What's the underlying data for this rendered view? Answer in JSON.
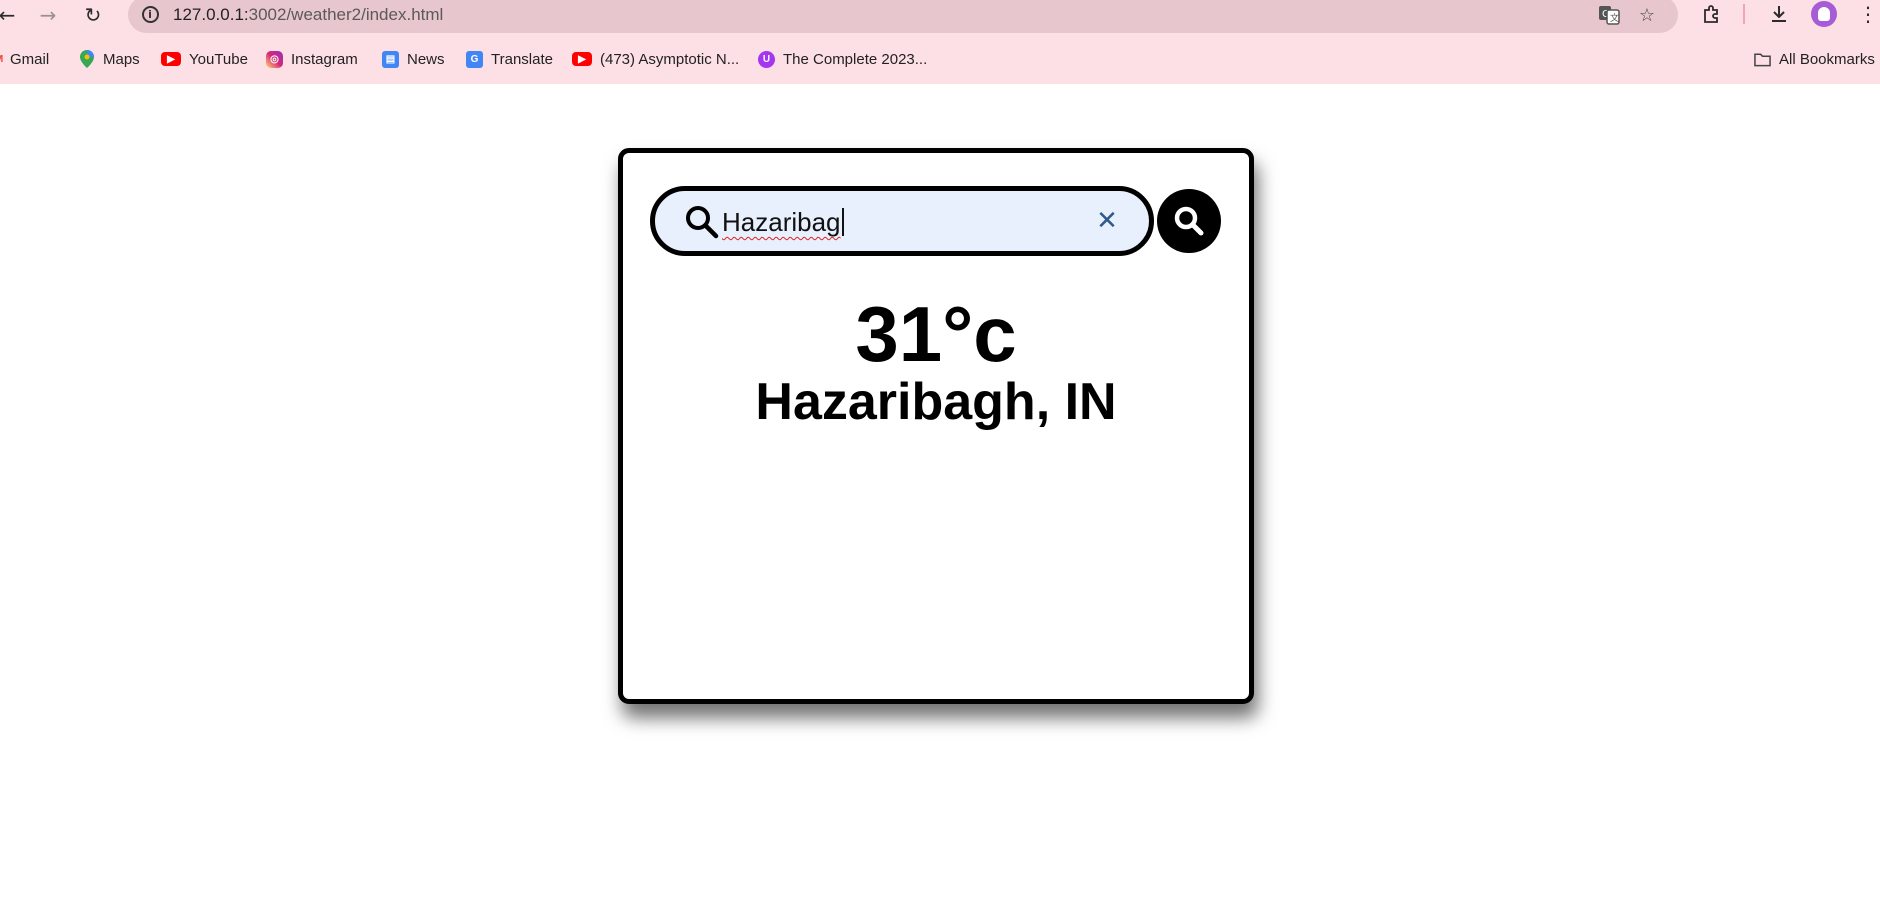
{
  "browser": {
    "url_host": "127.0.0.1:",
    "url_path": "3002/weather2/index.html",
    "bookmarks": [
      {
        "label": "Gmail",
        "icon": "gmail-icon",
        "color": "#ea4335"
      },
      {
        "label": "Maps",
        "icon": "maps-icon",
        "color": "#34a853"
      },
      {
        "label": "YouTube",
        "icon": "youtube-icon",
        "color": "#ff0000"
      },
      {
        "label": "Instagram",
        "icon": "instagram-icon",
        "color": "#d62976"
      },
      {
        "label": "News",
        "icon": "news-icon",
        "color": "#4285f4"
      },
      {
        "label": "Translate",
        "icon": "translate-icon",
        "color": "#4285f4"
      },
      {
        "label": "(473) Asymptotic N...",
        "icon": "youtube-icon",
        "color": "#ff0000"
      },
      {
        "label": "The Complete 2023...",
        "icon": "udemy-icon",
        "color": "#a435f0"
      }
    ],
    "all_bookmarks_label": "All Bookmarks"
  },
  "weather": {
    "search_value": "Hazaribag",
    "temperature": "31°c",
    "location": "Hazaribagh, IN"
  },
  "colors": {
    "chrome_bg": "#fde0e6",
    "omnibox_bg": "#e8c6cd",
    "search_field_bg": "#e8f0fe",
    "clear_icon": "#2f5a8a"
  }
}
